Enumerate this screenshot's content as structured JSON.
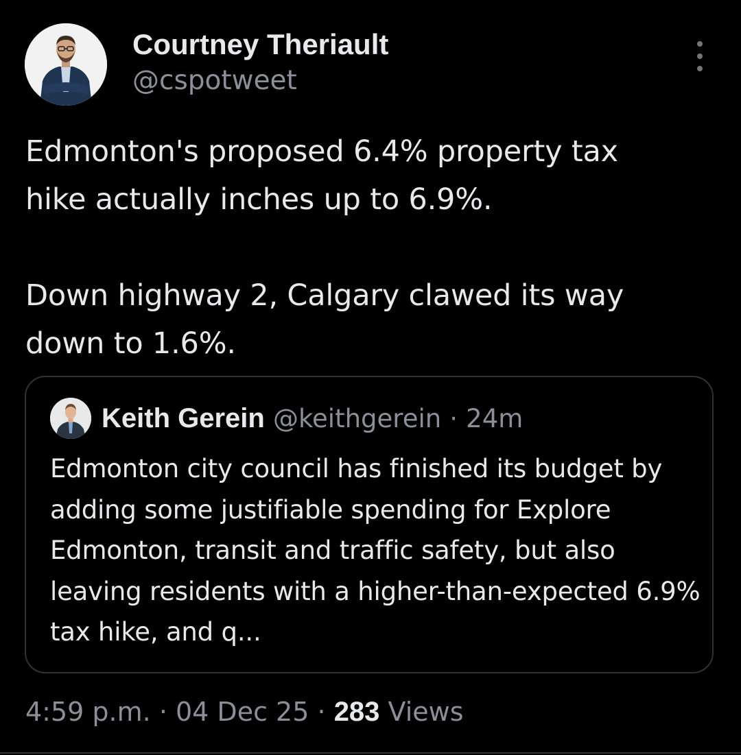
{
  "author": {
    "name": "Courtney Theriault",
    "handle": "@cspotweet"
  },
  "tweet": {
    "text": "Edmonton's proposed 6.4% property tax\nhike actually inches up to 6.9%.\n\nDown highway 2, Calgary clawed its way\ndown to 1.6%."
  },
  "quote": {
    "name": "Keith Gerein",
    "handle": "@keithgerein",
    "separator": "·",
    "time": "24m",
    "text": "Edmonton city council has finished its budget by adding some justifiable spending for Explore Edmonton, transit and traffic safety, but also leaving residents with a higher-than-expected 6.9% tax hike, and q..."
  },
  "meta": {
    "time": "4:59 p.m.",
    "separator": "·",
    "date": "04 Dec 25",
    "views_count": "283",
    "views_label": "Views"
  },
  "icons": {
    "more": "more-vertical-icon"
  },
  "colors": {
    "background": "#000000",
    "primary_text": "#e7e9ea",
    "secondary_text": "#8b9098",
    "border": "#2f3336"
  }
}
